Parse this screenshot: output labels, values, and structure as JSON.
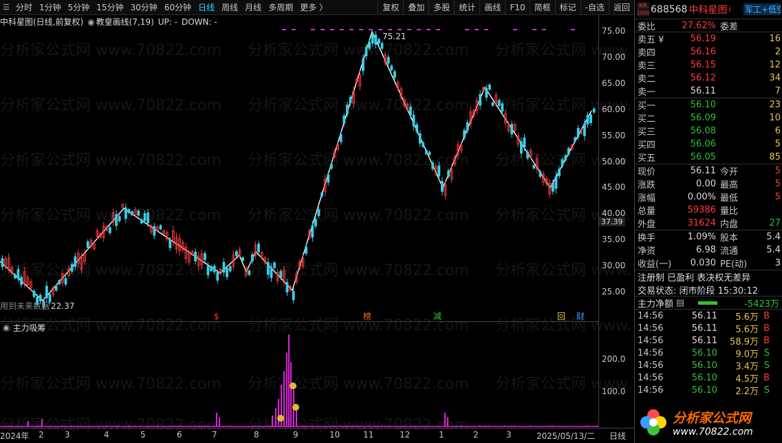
{
  "toolbar": {
    "periods": [
      "分时",
      "1分钟",
      "5分钟",
      "15分钟",
      "30分钟",
      "60分钟",
      "日线",
      "周线",
      "月线",
      "多周期",
      "更多 〉"
    ],
    "active_period": "日线",
    "right_buttons": [
      "复权",
      "叠加",
      "多股",
      "统计",
      "画线",
      "F10",
      "简框",
      "标记",
      "-自选",
      "返回"
    ]
  },
  "infobar": {
    "stock": "中科星图(日线,前复权)",
    "indicator": "教皇画线(7,19)",
    "up": "UP: -",
    "down": "DOWN: -"
  },
  "main_chart": {
    "yticks": [
      "75.00",
      "70.00",
      "65.00",
      "60.00",
      "55.00",
      "50.00",
      "45.00",
      "40.00",
      "35.00",
      "30.00",
      "25.00"
    ],
    "last_price_tag": "37.39",
    "high_label": "75.21",
    "low_label": "22.37",
    "overlay_text": "用到未来数据",
    "markers": [
      "$",
      "榜",
      "减",
      "回",
      "财"
    ]
  },
  "sub_chart": {
    "title": "主力吸筹",
    "yticks": [
      "200.0",
      "100.0"
    ]
  },
  "xaxis": {
    "labels": [
      "2024年",
      "2",
      "3",
      "4",
      "5",
      "6",
      "7",
      "8",
      "9",
      "10",
      "11",
      "12",
      "1",
      "2",
      "3",
      "2025/05/13/二"
    ],
    "period_label": "日线"
  },
  "quote": {
    "badge": "KR",
    "badge_sub": "1000",
    "code": "688568",
    "name": "中科星图",
    "tag": "军工+低空",
    "webi_label": "委比",
    "webi_value": "27.62%",
    "weicha_label": "委差",
    "asks": [
      {
        "label": "卖五 ¥",
        "price": "56.19",
        "vol": "16"
      },
      {
        "label": "卖四",
        "price": "56.16",
        "vol": "2"
      },
      {
        "label": "卖三",
        "price": "56.15",
        "vol": "12"
      },
      {
        "label": "卖二",
        "price": "56.12",
        "vol": "34"
      },
      {
        "label": "卖一",
        "price": "56.11",
        "vol": "7"
      }
    ],
    "bids": [
      {
        "label": "买一",
        "price": "56.10",
        "vol": "23"
      },
      {
        "label": "买二",
        "price": "56.09",
        "vol": "10"
      },
      {
        "label": "买三",
        "price": "56.08",
        "vol": "6"
      },
      {
        "label": "买四",
        "price": "56.06",
        "vol": "5"
      },
      {
        "label": "买五",
        "price": "56.05",
        "vol": "85"
      }
    ],
    "stats": [
      {
        "l1": "现价",
        "v1": "56.11",
        "l2": "今开",
        "v2": "5"
      },
      {
        "l1": "涨跌",
        "v1": "0.00",
        "l2": "最高",
        "v2": "5"
      },
      {
        "l1": "涨幅",
        "v1": "0.00%",
        "l2": "最低",
        "v2": "5"
      },
      {
        "l1": "总量",
        "v1": "59386",
        "l2": "量比",
        "v2": ""
      },
      {
        "l1": "外盘",
        "v1": "31624",
        "l2": "内盘",
        "v2": "27"
      }
    ],
    "stats2": [
      {
        "l1": "换手",
        "v1": "1.09%",
        "l2": "股本",
        "v2": "5.4"
      },
      {
        "l1": "净资",
        "v1": "6.98",
        "l2": "流通",
        "v2": "5.4"
      },
      {
        "l1": "收益(一)",
        "v1": "0.030",
        "l2": "PE(动)",
        "v2": "3"
      }
    ],
    "reg_line": "注册制 已盈利 表决权无差异",
    "status_line": "交易状态: 闭市阶段 15:30:12",
    "net_label": "主力净额",
    "net_value": "-5423万",
    "trades": [
      {
        "t": "14:56",
        "p": "56.11",
        "v": "5.6万",
        "bs": "B"
      },
      {
        "t": "14:56",
        "p": "56.11",
        "v": "5.6万",
        "bs": "B"
      },
      {
        "t": "14:56",
        "p": "56.11",
        "v": "58.9万",
        "bs": "B"
      },
      {
        "t": "14:56",
        "p": "56.10",
        "v": "9.0万",
        "bs": "S"
      },
      {
        "t": "14:56",
        "p": "56.10",
        "v": "3.4万",
        "bs": "S"
      },
      {
        "t": "14:56",
        "p": "56.10",
        "v": "4.5万",
        "bs": "B"
      },
      {
        "t": "14:56",
        "p": "56.10",
        "v": "2.2万",
        "bs": "S"
      }
    ]
  },
  "watermark": "分析家公式网 www.70822.com",
  "logo": {
    "title": "分析家公式网",
    "url": "www.70822.com"
  }
}
